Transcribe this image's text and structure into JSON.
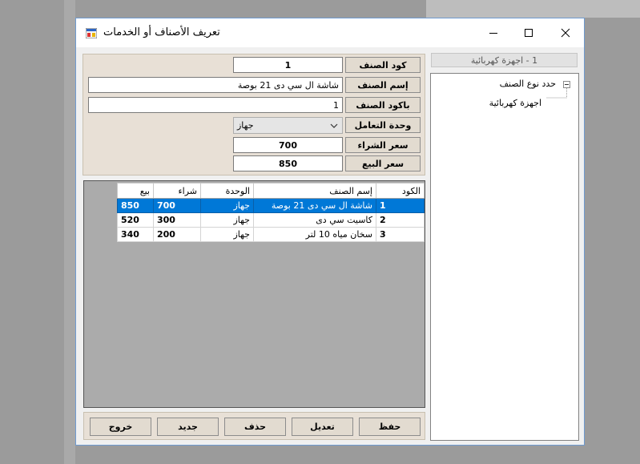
{
  "window": {
    "title": "تعريف الأصناف أو الخدمات"
  },
  "form": {
    "item_code": {
      "label": "كود الصنف",
      "value": "1"
    },
    "item_name": {
      "label": "إسم الصنف",
      "value": "شاشة ال سي دى 21 بوصة"
    },
    "barcode": {
      "label": "باكود الصنف",
      "value": "1"
    },
    "unit": {
      "label": "وحدة التعامل",
      "value": "جهاز"
    },
    "purchase_price": {
      "label": "سعر الشراء",
      "value": "700"
    },
    "sale_price": {
      "label": "سعر البيع",
      "value": "850"
    }
  },
  "grid": {
    "columns": [
      "الكود",
      "إسم الصنف",
      "الوحدة",
      "شراء",
      "بيع"
    ],
    "rows": [
      {
        "code": "1",
        "name": "شاشة ال سي دى 21 بوصة",
        "unit": "جهاز",
        "buy": "700",
        "sell": "850",
        "selected": true
      },
      {
        "code": "2",
        "name": "كاسيت سي دى",
        "unit": "جهاز",
        "buy": "300",
        "sell": "520",
        "selected": false
      },
      {
        "code": "3",
        "name": "سخان مياه 10 لتر",
        "unit": "جهاز",
        "buy": "200",
        "sell": "340",
        "selected": false
      }
    ]
  },
  "buttons": {
    "save": "حفظ",
    "edit": "تعديل",
    "delete": "حذف",
    "new": "جديد",
    "exit": "خروج"
  },
  "category_panel": {
    "header": "1 - اجهزة كهربائية",
    "tree_root": "حدد نوع الصنف",
    "tree_child": "اجهزة كهربائية"
  },
  "colors": {
    "selection": "#0078d7",
    "panel": "#e8e0d6"
  },
  "icons": {
    "app": "app-icon",
    "minimize": "minimize-icon",
    "maximize": "maximize-icon",
    "close": "close-icon",
    "dropdown": "chevron-down-icon",
    "collapse": "tree-collapse-icon"
  }
}
